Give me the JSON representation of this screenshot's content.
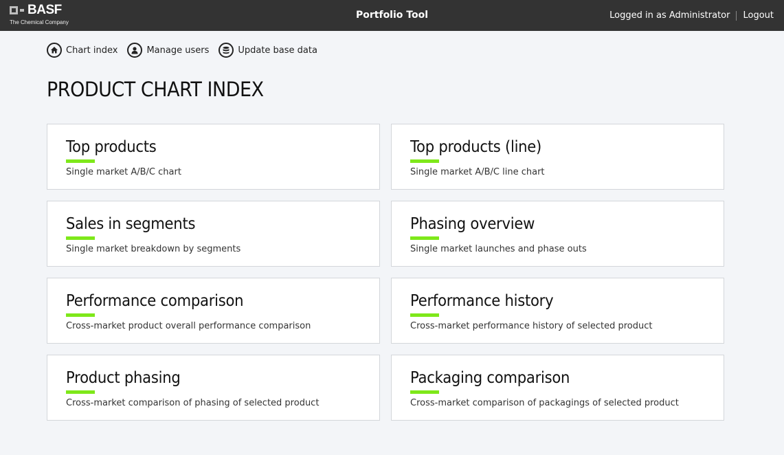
{
  "header": {
    "brand": "BASF",
    "brand_sub": "The Chemical Company",
    "app_title": "Portfolio Tool",
    "logged_in_text": "Logged in as Administrator",
    "logout_label": "Logout",
    "background": "#333333"
  },
  "nav": {
    "items": [
      {
        "label": "Chart index",
        "icon": "home-icon"
      },
      {
        "label": "Manage users",
        "icon": "user-icon"
      },
      {
        "label": "Update base data",
        "icon": "database-icon"
      }
    ]
  },
  "page": {
    "title": "PRODUCT CHART INDEX"
  },
  "accent_color": "#7ee81a",
  "cards": [
    {
      "title": "Top products",
      "description": "Single market A/B/C chart"
    },
    {
      "title": "Top products (line)",
      "description": "Single market A/B/C line chart"
    },
    {
      "title": "Sales in segments",
      "description": "Single market breakdown by segments"
    },
    {
      "title": "Phasing overview",
      "description": "Single market launches and phase outs"
    },
    {
      "title": "Performance comparison",
      "description": "Cross-market product overall performance comparison"
    },
    {
      "title": "Performance history",
      "description": "Cross-market performance history of selected product"
    },
    {
      "title": "Product phasing",
      "description": "Cross-market comparison of phasing of selected product"
    },
    {
      "title": "Packaging comparison",
      "description": "Cross-market comparison of packagings of selected product"
    }
  ]
}
